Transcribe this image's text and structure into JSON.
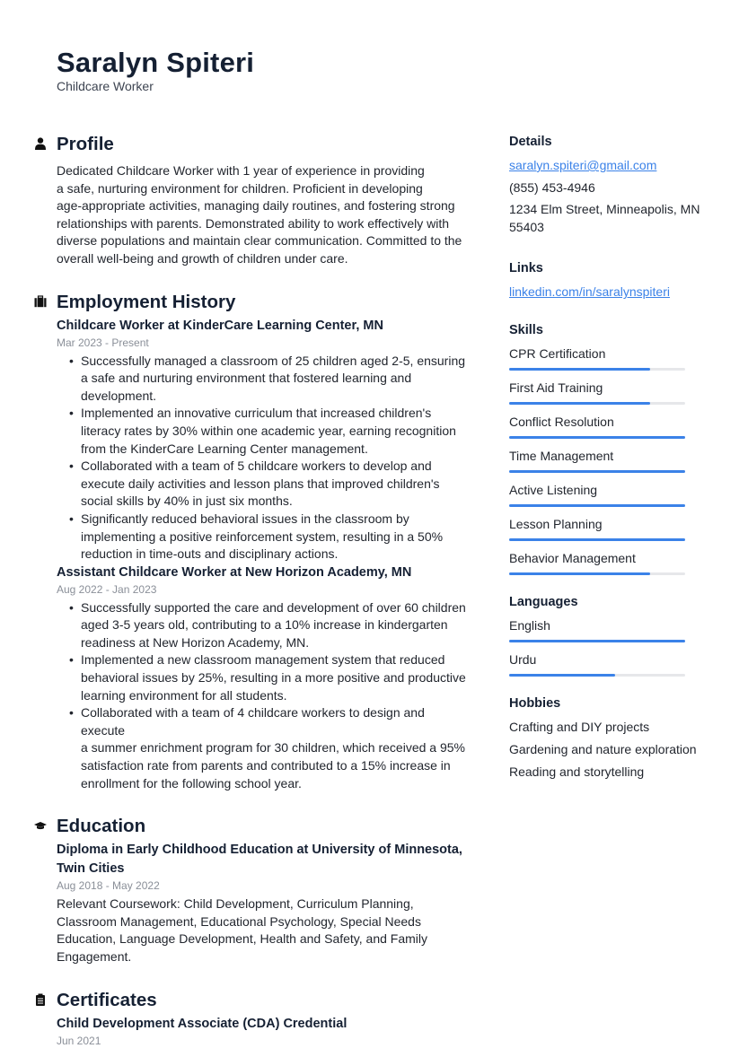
{
  "header": {
    "name": "Saralyn Spiteri",
    "title": "Childcare Worker"
  },
  "profile": {
    "heading": "Profile",
    "icon": "person-icon",
    "lines": [
      "Dedicated Childcare Worker with 1 year of experience in providing",
      "a safe, nurturing environment for children. Proficient in developing",
      "age-appropriate activities, managing daily routines, and fostering strong",
      "relationships with parents. Demonstrated ability to work effectively with",
      "diverse populations and maintain clear communication. Committed to the",
      "overall well-being and growth of children under care."
    ]
  },
  "employment": {
    "heading": "Employment History",
    "icon": "briefcase-icon",
    "jobs": [
      {
        "title": "Childcare Worker at KinderCare Learning Center, MN",
        "date": "Mar 2023 - Present",
        "bullets": [
          [
            "Successfully managed a classroom of 25 children aged 2-5, ensuring",
            "a safe and nurturing environment that fostered learning and",
            "development."
          ],
          [
            "Implemented an innovative curriculum that increased children's",
            "literacy rates by 30% within one academic year, earning recognition",
            "from the KinderCare Learning Center management."
          ],
          [
            "Collaborated with a team of 5 childcare workers to develop and",
            "execute daily activities and lesson plans that improved children's",
            "social skills by 40% in just six months."
          ],
          [
            "Significantly reduced behavioral issues in the classroom by",
            "implementing a positive reinforcement system, resulting in a 50%",
            "reduction in time-outs and disciplinary actions."
          ]
        ]
      },
      {
        "title": "Assistant Childcare Worker at New Horizon Academy, MN",
        "date": "Aug 2022 - Jan 2023",
        "bullets": [
          [
            "Successfully supported the care and development of over 60 children",
            "aged 3-5 years old, contributing to a 10% increase in kindergarten",
            "readiness at New Horizon Academy, MN."
          ],
          [
            "Implemented a new classroom management system that reduced",
            "behavioral issues by 25%, resulting in a more positive and productive",
            "learning environment for all students."
          ],
          [
            "Collaborated with a team of 4 childcare workers to design and execute",
            "a summer enrichment program for 30 children, which received a 95%",
            "satisfaction rate from parents and contributed to a 15% increase in",
            "enrollment for the following school year."
          ]
        ]
      }
    ]
  },
  "education": {
    "heading": "Education",
    "icon": "graduation-cap-icon",
    "entries": [
      {
        "title_lines": [
          "Diploma in Early Childhood Education at University of Minnesota,",
          "Twin Cities"
        ],
        "date": "Aug 2018 - May 2022",
        "desc_lines": [
          "Relevant Coursework: Child Development, Curriculum Planning,",
          "Classroom Management, Educational Psychology, Special Needs",
          "Education, Language Development, Health and Safety, and Family",
          "Engagement."
        ]
      }
    ]
  },
  "certificates": {
    "heading": "Certificates",
    "icon": "clipboard-icon",
    "entries": [
      {
        "title": "Child Development Associate (CDA) Credential",
        "date": "Jun 2021"
      }
    ]
  },
  "details": {
    "heading": "Details",
    "email": "saralyn.spiteri@gmail.com",
    "phone": "(855) 453-4946",
    "address_lines": [
      "1234 Elm Street, Minneapolis, MN",
      "55403"
    ]
  },
  "links": {
    "heading": "Links",
    "items": [
      "linkedin.com/in/saralynspiteri"
    ]
  },
  "skills": {
    "heading": "Skills",
    "items": [
      {
        "label": "CPR Certification",
        "level": 0.8
      },
      {
        "label": "First Aid Training",
        "level": 0.8
      },
      {
        "label": "Conflict Resolution",
        "level": 1.0
      },
      {
        "label": "Time Management",
        "level": 1.0
      },
      {
        "label": "Active Listening",
        "level": 1.0
      },
      {
        "label": "Lesson Planning",
        "level": 1.0
      },
      {
        "label": "Behavior Management",
        "level": 0.8
      }
    ]
  },
  "languages": {
    "heading": "Languages",
    "items": [
      {
        "label": "English",
        "level": 1.0
      },
      {
        "label": "Urdu",
        "level": 0.6
      }
    ]
  },
  "hobbies": {
    "heading": "Hobbies",
    "items": [
      "Crafting and DIY projects",
      "Gardening and nature exploration",
      "Reading and storytelling"
    ]
  },
  "colors": {
    "accent": "#3b82e8",
    "bar_track": "#e6e7ea",
    "heading": "#152033",
    "muted": "#8a8f98"
  }
}
